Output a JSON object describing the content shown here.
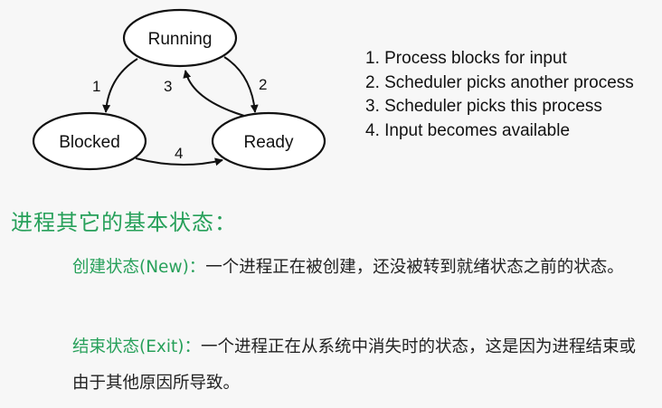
{
  "diagram": {
    "nodes": {
      "running": "Running",
      "blocked": "Blocked",
      "ready": "Ready"
    },
    "edges": {
      "e1": "1",
      "e2": "2",
      "e3": "3",
      "e4": "4"
    }
  },
  "legend": [
    "1. Process blocks for input",
    "2. Scheduler picks another process",
    "3. Scheduler picks this process",
    "4. Input becomes available"
  ],
  "heading": "进程其它的基本状态：",
  "paragraphs": [
    {
      "term": "创建状态(New)：",
      "text": "一个进程正在被创建，还没被转到就绪状态之前的状态。"
    },
    {
      "term": "结束状态(Exit)：",
      "text": "一个进程正在从系统中消失时的状态，这是因为进程结束或由于其他原因所导致。"
    }
  ],
  "colors": {
    "accent_green": "#27a05a",
    "text": "#222222",
    "background": "#f7f7f7"
  }
}
